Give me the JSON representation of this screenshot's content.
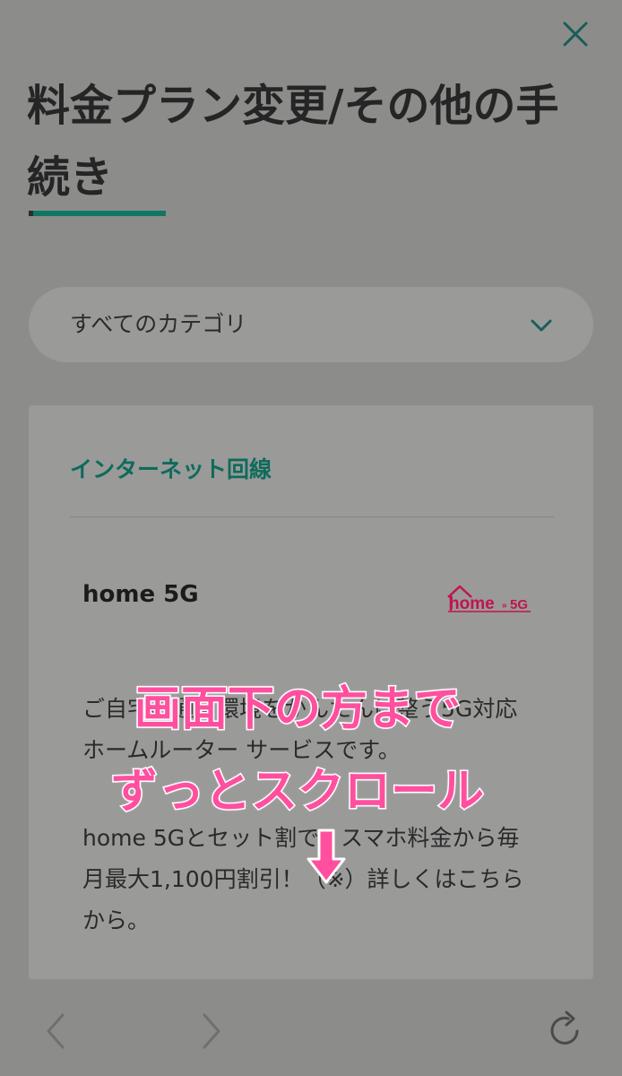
{
  "header": {
    "title": "料金プラン変更/その他の手続き",
    "close_icon": "close-icon"
  },
  "category_select": {
    "selected": "すべてのカテゴリ"
  },
  "section": {
    "heading": "インターネット回線",
    "service_name": "home 5G",
    "logo_text": "home",
    "logo_suffix": "5G",
    "desc1": "ご自宅の通信環境をかんたんに整う5G対応ホームルーター サービスです。",
    "desc2": "home 5Gとセット割で、スマホ料金から毎月最大1,100円割引！（※）詳しくはこちらから。"
  },
  "overlay": {
    "line1": "画面下の方まで",
    "line2": "ずっとスクロール"
  },
  "bottom_nav": {
    "back_icon": "chevron-left-icon",
    "forward_icon": "chevron-right-icon",
    "reload_icon": "reload-icon"
  },
  "colors": {
    "accent": "#0f7662",
    "overlay_pink": "#ff4f9e",
    "logo_red": "#c0154f"
  }
}
